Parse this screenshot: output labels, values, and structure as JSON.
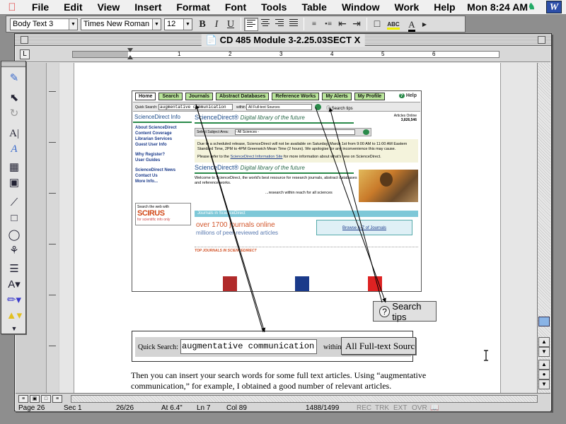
{
  "menubar": {
    "menus": [
      "File",
      "Edit",
      "View",
      "Insert",
      "Format",
      "Font",
      "Tools",
      "Table",
      "Window",
      "Work",
      "Help"
    ],
    "clock": "Mon 8:24 AM"
  },
  "toolbar": {
    "style": "Body Text 3",
    "font": "Times New Roman",
    "size": "12",
    "bold": "B",
    "italic": "I",
    "underline": "U",
    "spell": "ABC",
    "font_color": "A"
  },
  "window": {
    "title": "CD 485 Module 3-2.25.03SECT X"
  },
  "ruler": {
    "numbers": [
      "1",
      "2",
      "3",
      "4",
      "5",
      "6"
    ]
  },
  "screenshot": {
    "nav": [
      "Home",
      "Search",
      "Journals",
      "Abstract Databases",
      "Reference Works",
      "My Alerts",
      "My Profile"
    ],
    "help": "Help",
    "quick_search_label": "Quick Search:",
    "quick_search_value": "augmentative communication",
    "within": "within",
    "source": "All Full-text Sources",
    "search_tips": "Search tips",
    "side_heading": "ScienceDirect Info",
    "side_links": [
      "About ScienceDirect",
      "Content Coverage",
      "Librarian Services",
      "Guest User Info"
    ],
    "side_links2": [
      "Why Register?",
      "User Guides"
    ],
    "side_links3": [
      "ScienceDirect News",
      "Contact Us",
      "More Info..."
    ],
    "scirus_top": "Search the web with",
    "scirus_logo": "SCIRUS",
    "scirus_tag": "for scientific info only",
    "brand": "ScienceDirect",
    "brand_tag": "Digital library of the future",
    "articles_online_label": "Articles Online",
    "articles_online_value": "3,826,546",
    "subject_area_label": "Select Subject Area:",
    "subject_area_value": "- All Sciences -",
    "notice": "Due to a scheduled release, ScienceDirect will not be available on Saturday, March 1st from 9:00 AM to 11:00 AM Eastern Standard Time, 2PM to 4PM Greenwich Mean Time (2 hours). We apologise for any inconvenience this may cause.",
    "notice2_pre": "Please refer to the",
    "notice2_link": "ScienceDirect Information Site",
    "notice2_post": "for more information about what's new on ScienceDirect.",
    "welcome": "Welcome to ScienceDirect, the world's best resource for research journals, abstract databases and reference works.",
    "welcome_tag": "...research within reach for all sciences",
    "journals_bar": "Journals in ScienceDirect",
    "journals_big": "over 1700 journals online",
    "journals_sub": "millions of peer-reviewed articles",
    "browse": "Browse A-Z of Journals",
    "top_journals": "TOP JOURNALS IN SCIENCEDIRECT"
  },
  "callouts": {
    "search_tips": "Search tips",
    "quick_search_label": "Quick Search:",
    "quick_search_value": "augmentative communication",
    "within": "within",
    "source": "All Full-text Sources"
  },
  "body": {
    "text": "Then you can insert your search words for some full text articles.  Using “augmentative communication,” for example, I obtained a good number of relevant articles."
  },
  "status": {
    "page": "Page 26",
    "sec": "Sec 1",
    "pages": "26/26",
    "at": "At 6.4\"",
    "ln": "Ln 7",
    "col": "Col 89",
    "words": "1488/1499",
    "rec": "REC",
    "trk": "TRK",
    "ext": "EXT",
    "ovr": "OVR"
  }
}
